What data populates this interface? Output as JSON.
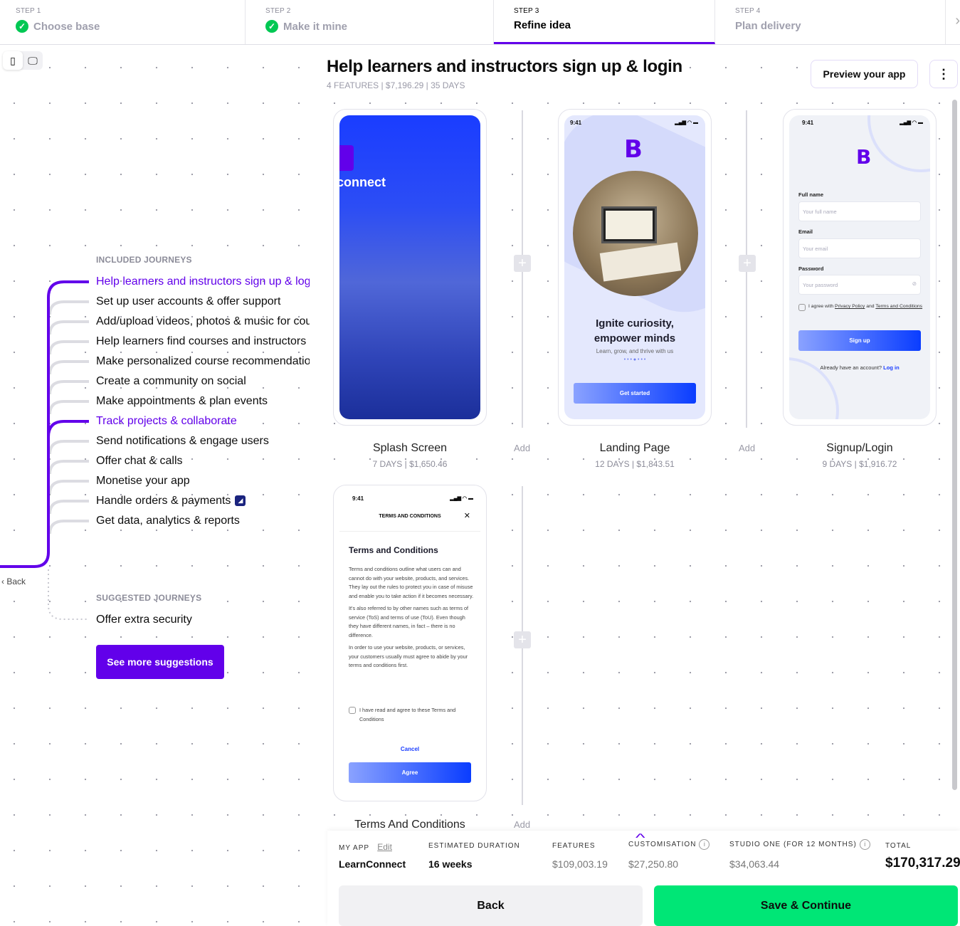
{
  "steps": [
    {
      "label": "STEP 1",
      "title": "Choose base",
      "done": true
    },
    {
      "label": "STEP 2",
      "title": "Make it mine",
      "done": true
    },
    {
      "label": "STEP 3",
      "title": "Refine idea",
      "done": false
    },
    {
      "label": "STEP 4",
      "title": "Plan delivery",
      "done": false
    }
  ],
  "header": {
    "title": "Help learners and instructors sign up & login",
    "subtitle": "4 FEATURES | $7,196.29 | 35 DAYS",
    "preview_label": "Preview your app"
  },
  "colors": {
    "accent": "#6200ea",
    "success": "#00e676",
    "check": "#00c853"
  },
  "journeys": {
    "included_heading": "INCLUDED JOURNEYS",
    "included": [
      {
        "label": "Help learners and instructors sign up & login",
        "selected": true
      },
      {
        "label": "Set up user accounts & offer support"
      },
      {
        "label": "Add/upload videos, photos & music for courses"
      },
      {
        "label": "Help learners find courses and instructors"
      },
      {
        "label": "Make personalized course recommendations"
      },
      {
        "label": "Create a community on social"
      },
      {
        "label": "Make appointments & plan events"
      },
      {
        "label": "Track projects & collaborate",
        "selected": true
      },
      {
        "label": "Send notifications & engage users"
      },
      {
        "label": "Offer chat & calls"
      },
      {
        "label": "Monetise your app"
      },
      {
        "label": "Handle orders & payments",
        "badge": true
      },
      {
        "label": "Get data, analytics & reports"
      }
    ],
    "suggested_heading": "SUGGESTED JOURNEYS",
    "suggested": [
      "Offer extra security"
    ],
    "see_more": "See more suggestions",
    "back": "Back"
  },
  "features": [
    {
      "name": "Splash Screen",
      "meta": "7 DAYS | $1,650.46",
      "screen": {
        "text": "connect"
      }
    },
    {
      "name": "Landing Page",
      "meta": "12 DAYS | $1,843.51",
      "screen": {
        "time": "9:41",
        "headline1": "Ignite curiosity,",
        "headline2": "empower minds",
        "tagline": "Learn, grow, and thrive with us",
        "cta": "Get started"
      }
    },
    {
      "name": "Signup/Login",
      "meta": "9 DAYS | $1,916.72",
      "screen": {
        "time": "9:41",
        "fullname_label": "Full name",
        "fullname_ph": "Your full name",
        "email_label": "Email",
        "email_ph": "Your email",
        "password_label": "Password",
        "password_ph": "Your password",
        "agree_pre": "I agree with ",
        "privacy": "Privacy Policy",
        "and": " and ",
        "terms": "Terms and Conditions",
        "signup": "Sign up",
        "have_account": "Already have an account? ",
        "login": "Log in"
      }
    },
    {
      "name": "Terms And Conditions",
      "meta": "",
      "screen": {
        "time": "9:41",
        "header": "TERMS AND CONDITIONS",
        "heading": "Terms and Conditions",
        "p1": "Terms and conditions outline what users can and cannot do with your website, products, and services. They lay out the rules to protect you in case of misuse and enable you to take action if it becomes necessary.",
        "p2": "It's also referred to by other names such as terms of service (ToS) and terms of use (ToU). Even though they have different names, in fact – there is no difference.",
        "p3": "In order to use your website, products, or services, your customers usually must agree to abide by your terms and conditions first.",
        "check": "I have read and agree to these Terms and Conditions",
        "cancel": "Cancel",
        "agree": "Agree"
      }
    }
  ],
  "add_label": "Add",
  "summary": {
    "my_app_label": "MY APP",
    "edit": "Edit",
    "app_name": "LearnConnect",
    "duration_label": "ESTIMATED DURATION",
    "duration": "16 weeks",
    "features_label": "FEATURES",
    "features": "$109,003.19",
    "custom_label": "CUSTOMISATION",
    "custom": "$27,250.80",
    "studio_label": "STUDIO ONE (FOR 12 MONTHS)",
    "studio": "$34,063.44",
    "total_label": "TOTAL",
    "total": "$170,317.29",
    "back": "Back",
    "save": "Save & Continue"
  }
}
